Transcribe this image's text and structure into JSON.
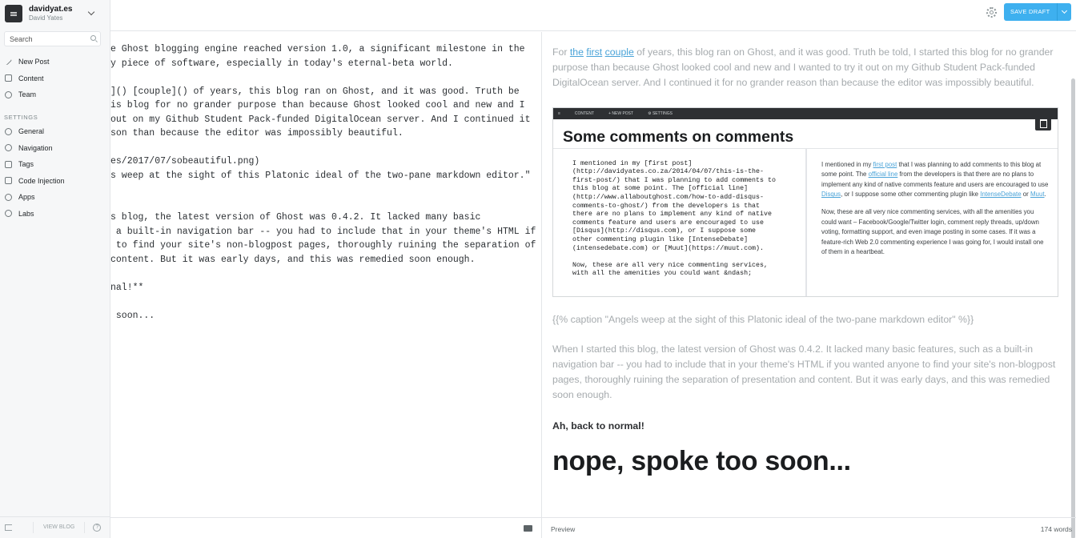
{
  "blog": {
    "title": "davidyat.es",
    "user": "David Yates"
  },
  "search": {
    "placeholder": "Search"
  },
  "nav": {
    "main": [
      "New Post",
      "Content",
      "Team"
    ],
    "settings_label": "SETTINGS",
    "settings": [
      "General",
      "Navigation",
      "Tags",
      "Code Injection",
      "Apps",
      "Labs"
    ]
  },
  "footer": {
    "view_blog": "VIEW BLOG",
    "help": "?"
  },
  "toolbar": {
    "save_label": "SAVE DRAFT"
  },
  "editor": {
    "lines": [
      "e Ghost blogging engine reached version 1.0, a significant milestone in the",
      "y piece of software, especially in today's eternal-beta world.",
      "",
      "]() [couple]() of years, this blog ran on Ghost, and it was good. Truth be",
      "is blog for no grander purpose than because Ghost looked cool and new and I",
      "out on my Github Student Pack-funded DigitalOcean server. And I continued it",
      "son than because the editor was impossibly beautiful.",
      "",
      "es/2017/07/sobeautiful.png)",
      "s weep at the sight of this Platonic ideal of the two-pane markdown editor.\"",
      "",
      "",
      "s blog, the latest version of Ghost was 0.4.2. It lacked many basic",
      " a built-in navigation bar -- you had to include that in your theme's HTML if",
      " to find your site's non-blogpost pages, thoroughly ruining the separation of",
      "content. But it was early days, and this was remedied soon enough.",
      "",
      "nal!**",
      "",
      " soon..."
    ]
  },
  "preview": {
    "p1_before": "For ",
    "p1_links": [
      "the",
      "first",
      "couple"
    ],
    "p1_after": " of years, this blog ran on Ghost, and it was good. Truth be told, I started this blog for no grander purpose than because Ghost looked cool and new and I wanted to try it out on my Github Student Pack-funded DigitalOcean server. And I continued it for no grander reason than because the editor was impossibly beautiful.",
    "shot": {
      "bar_items": [
        "≡",
        "CONTENT",
        "+ NEW POST",
        "⚙ SETTINGS"
      ],
      "title": "Some comments on comments",
      "left_text": "I mentioned in my [first post]\n(http://davidyates.co.za/2014/04/07/this-is-the-\nfirst-post/) that I was planning to add comments to\nthis blog at some point. The [official line]\n(http://www.allaboutghost.com/how-to-add-disqus-\ncomments-to-ghost/) from the developers is that\nthere are no plans to implement any kind of native\ncomments feature and users are encouraged to use\n[Disqus](http://disqus.com), or I suppose some\nother commenting plugin like [IntenseDebate]\n(intensedebate.com) or [Muut](https://muut.com).\n\nNow, these are all very nice commenting services,\nwith all the amenities you could want &ndash;",
      "right_p1a": "I mentioned in my ",
      "right_link1": "first post",
      "right_p1b": " that I was planning to add comments to this blog at some point. The ",
      "right_link2": "official line",
      "right_p1c": " from the developers is that there are no plans to implement any kind of native comments feature and users are encouraged to use ",
      "right_link3": "Disqus",
      "right_p1d": ", or I suppose some other commenting plugin like ",
      "right_link4": "IntenseDebate",
      "right_p1e": " or ",
      "right_link5": "Muut",
      "right_p1f": ".",
      "right_p2": "Now, these are all very nice commenting services, with all the amenities you could want – Facebook/Google/Twitter login, comment reply threads, up/down voting, formatting support, and even image posting in some cases. If it was a feature-rich Web 2.0 commenting experience I was going for, I would install one of them in a heartbeat."
    },
    "caption": "{{% caption \"Angels weep at the sight of this Platonic ideal of the two-pane markdown editor\" %}}",
    "p2": "When I started this blog, the latest version of Ghost was 0.4.2. It lacked many basic features, such as a built-in navigation bar -- you had to include that in your theme's HTML if you wanted anyone to find your site's non-blogpost pages, thoroughly ruining the separation of presentation and content. But it was early days, and this was remedied soon enough.",
    "bold": "Ah, back to normal!",
    "heading": "nope, spoke too soon..."
  },
  "status": {
    "preview_label": "Preview",
    "word_count": "174 words"
  },
  "colors": {
    "accent": "#3eb0ef",
    "sidebar_bg": "#f6f7f8",
    "link": "#4aa3d8"
  }
}
